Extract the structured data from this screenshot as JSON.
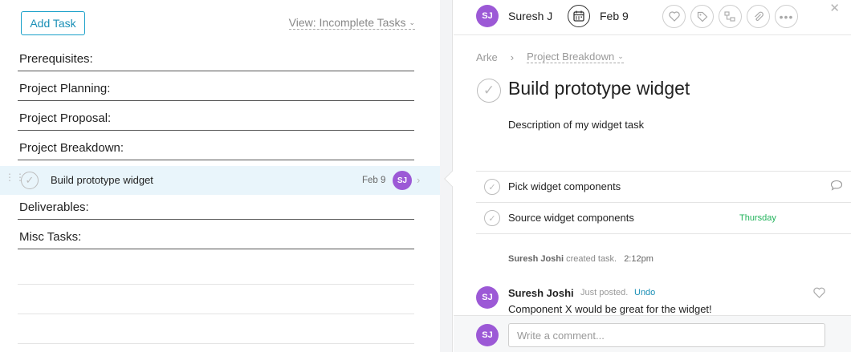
{
  "colors": {
    "accent": "#18a0c9",
    "avatar": "#9c59d6",
    "selected_row": "#e9f5fb",
    "due_green": "#21b35b"
  },
  "list": {
    "add_task_label": "Add Task",
    "view_filter_label": "View: Incomplete Tasks",
    "sections": {
      "prerequisites": "Prerequisites:",
      "planning": "Project Planning:",
      "proposal": "Project Proposal:",
      "breakdown": "Project Breakdown:",
      "deliverables": "Deliverables:",
      "misc": "Misc Tasks:"
    },
    "selected_task": {
      "name": "Build prototype widget",
      "due": "Feb 9",
      "assignee_initials": "SJ"
    }
  },
  "detail": {
    "assignee": {
      "initials": "SJ",
      "name": "Suresh J"
    },
    "due_date": "Feb 9",
    "toolbar_icons": [
      "heart-icon",
      "tag-icon",
      "subtasks-icon",
      "attachment-icon",
      "more-icon"
    ],
    "breadcrumb": {
      "workspace": "Arke",
      "project": "Project Breakdown"
    },
    "title": "Build prototype widget",
    "description": "Description of my widget task",
    "subtasks": [
      {
        "name": "Pick widget components",
        "due": ""
      },
      {
        "name": "Source widget components",
        "due": "Thursday"
      }
    ],
    "activity": {
      "actor": "Suresh Joshi",
      "action": "created task.",
      "time": "2:12pm"
    },
    "comment": {
      "initials": "SJ",
      "author": "Suresh Joshi",
      "meta": "Just posted.",
      "undo": "Undo",
      "text": "Component X would be great for the widget!"
    },
    "composer": {
      "initials": "SJ",
      "placeholder": "Write a comment..."
    }
  }
}
